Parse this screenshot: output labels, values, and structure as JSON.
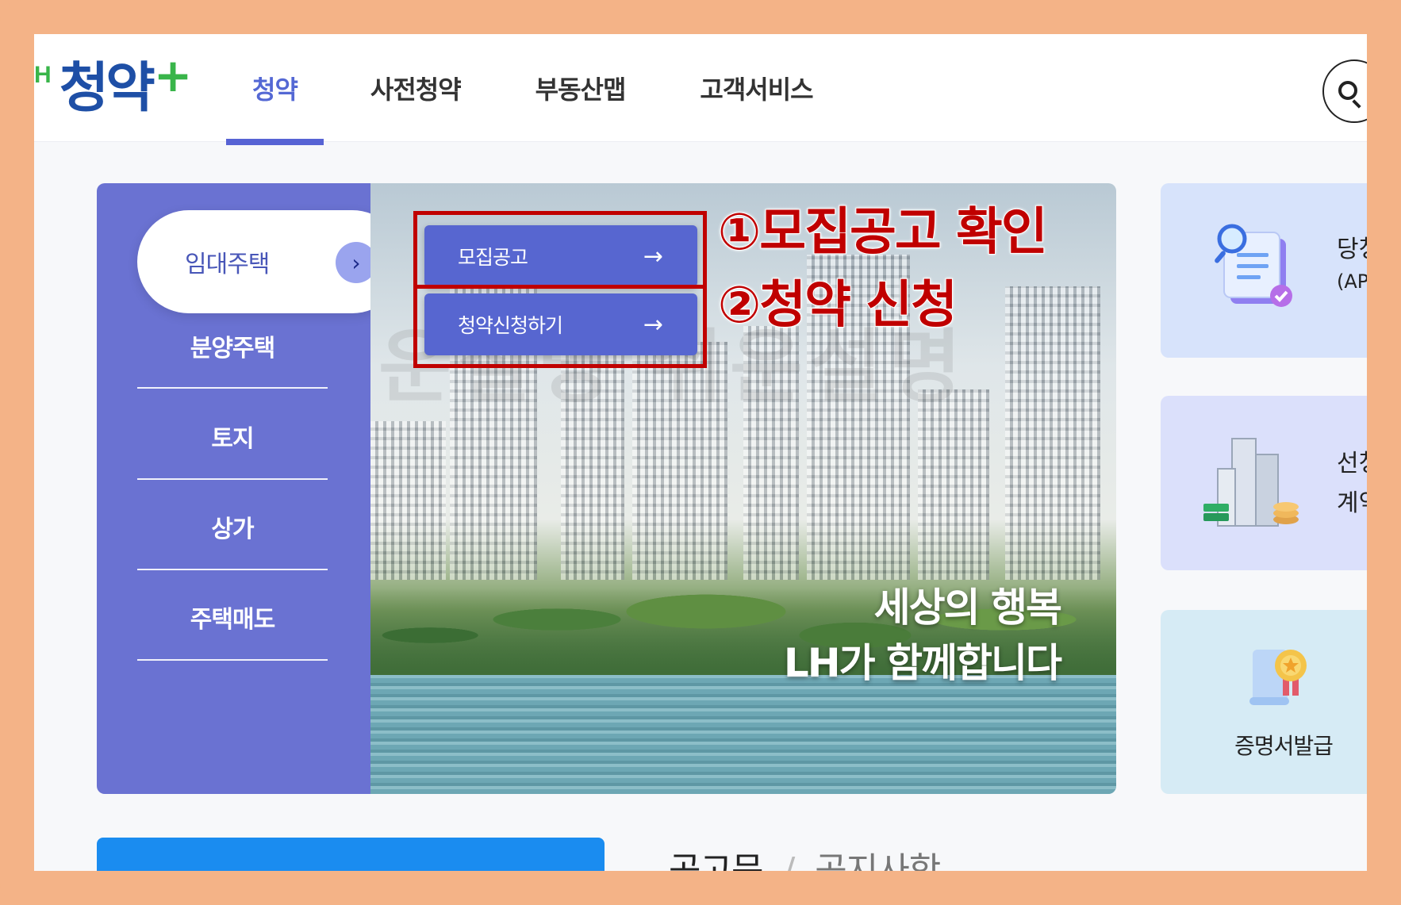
{
  "logo": {
    "prefix": "H",
    "text": "청약",
    "plus": "+"
  },
  "nav": {
    "items": [
      {
        "label": "청약",
        "active": true
      },
      {
        "label": "사전청약",
        "active": false
      },
      {
        "label": "부동산맵",
        "active": false
      },
      {
        "label": "고객서비스",
        "active": false
      }
    ]
  },
  "side_menu": {
    "active_label": "임대주택",
    "items": [
      "분양주택",
      "토지",
      "상가",
      "주택매도"
    ]
  },
  "hero": {
    "tagline_line1": "세상의 행복",
    "tagline_line2": "LH가 함께합니다",
    "watermark": "쉬운설명 쉬운설명"
  },
  "quick_buttons": {
    "notice": "모집공고",
    "apply": "청약신청하기",
    "arrow": "→"
  },
  "annotations": {
    "step1": "①모집공고 확인",
    "step2": "②청약 신청"
  },
  "cards": {
    "card1_line1": "당청",
    "card1_line2": "(AP",
    "card2_line1": "선청",
    "card2_line2": "계약",
    "card3_label": "증명서발급"
  },
  "bottom": {
    "tab1": "공고문",
    "sep": "/",
    "tab2": "공지사항"
  },
  "colors": {
    "frame": "#f4b387",
    "brand_blue": "#1e4fa6",
    "brand_green": "#39b54a",
    "menu_purple": "#6a72d2",
    "button_blue": "#5766d0",
    "annotation_red": "#c00000"
  }
}
